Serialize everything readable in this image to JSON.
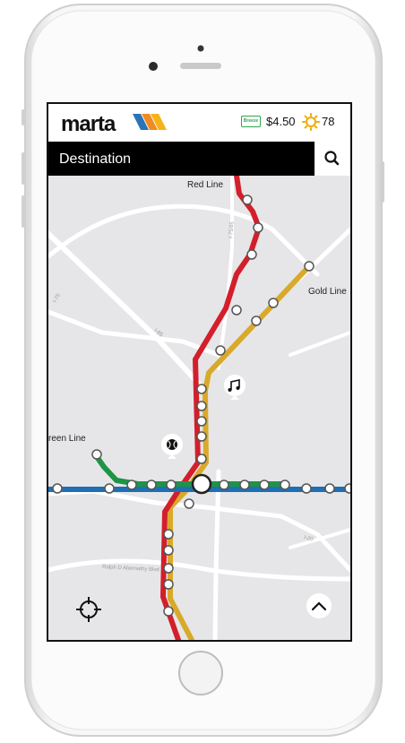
{
  "header": {
    "logo_text": "marta",
    "fare_card_label": "Breeze",
    "fare": "$4.50",
    "weather_icon": "sun-icon",
    "temperature": "78"
  },
  "destination": {
    "placeholder": "Destination",
    "search_icon": "search-icon"
  },
  "map": {
    "line_labels": {
      "red": "Red Line",
      "gold": "Gold Line",
      "green": "reen Line"
    },
    "road_labels": [
      "I-75",
      "I-85",
      "I-20",
      "I-75/85",
      "Ralph D Abernathy Blvd"
    ],
    "poi_icons": [
      "music-note-icon",
      "baseball-icon"
    ],
    "colors": {
      "red": "#d31f2b",
      "gold": "#d9a929",
      "green": "#1e9447",
      "blue": "#1f6fb4",
      "map_bg": "#e6e6e8"
    }
  },
  "controls": {
    "locate_icon": "crosshair-icon",
    "expand_icon": "chevron-up-icon"
  }
}
